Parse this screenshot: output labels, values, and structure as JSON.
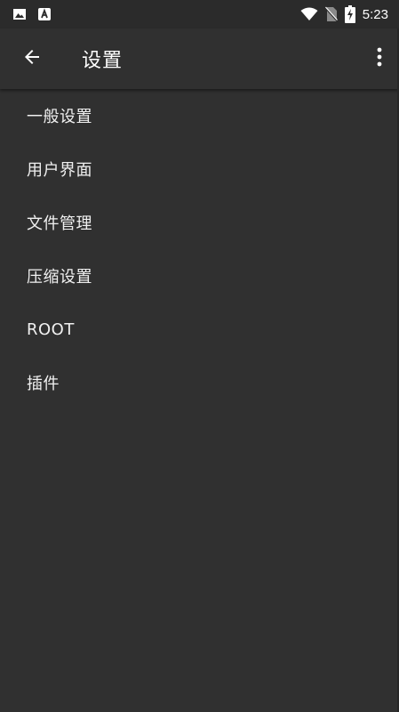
{
  "status_bar": {
    "time": "5:23",
    "icons": [
      "image-icon",
      "app-a-icon",
      "wifi-icon",
      "no-sim-icon",
      "battery-charging-icon"
    ]
  },
  "app_bar": {
    "title": "设置",
    "back_icon": "arrow-back-icon",
    "menu_icon": "more-vert-icon"
  },
  "settings": {
    "items": [
      {
        "label": "一般设置"
      },
      {
        "label": "用户界面"
      },
      {
        "label": "文件管理"
      },
      {
        "label": "压缩设置"
      },
      {
        "label": "ROOT"
      },
      {
        "label": "插件"
      }
    ]
  },
  "colors": {
    "background": "#303030",
    "status_bar": "#2b2b2b",
    "text": "#ffffff"
  }
}
